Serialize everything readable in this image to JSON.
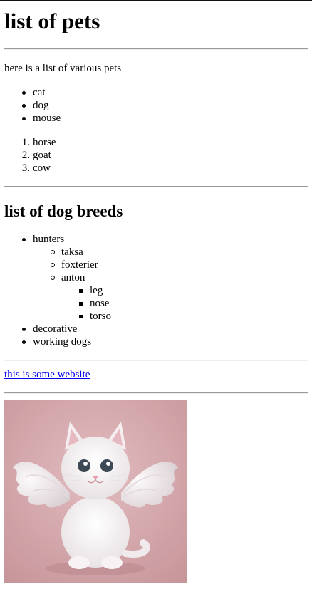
{
  "title": "list of pets",
  "intro": "here is a list of various pets",
  "pets_unordered": [
    "cat",
    "dog",
    "mouse"
  ],
  "pets_ordered": [
    {
      "num": "1.",
      "label": "horse"
    },
    {
      "num": "2.",
      "label": "goat"
    },
    {
      "num": "3.",
      "label": "cow"
    }
  ],
  "breeds_heading": "list of dog breeds",
  "breeds": {
    "hunters": "hunters",
    "hunters_sub": {
      "taksa": "taksa",
      "foxterier": "foxterier",
      "anton": "anton",
      "anton_sub": [
        "leg",
        "nose",
        "torso"
      ]
    },
    "decorative": "decorative",
    "working": "working dogs"
  },
  "link_text": "this is some website",
  "image": {
    "subject": "white-kitten-with-angel-wings",
    "background_color": "#d4a7aa"
  }
}
